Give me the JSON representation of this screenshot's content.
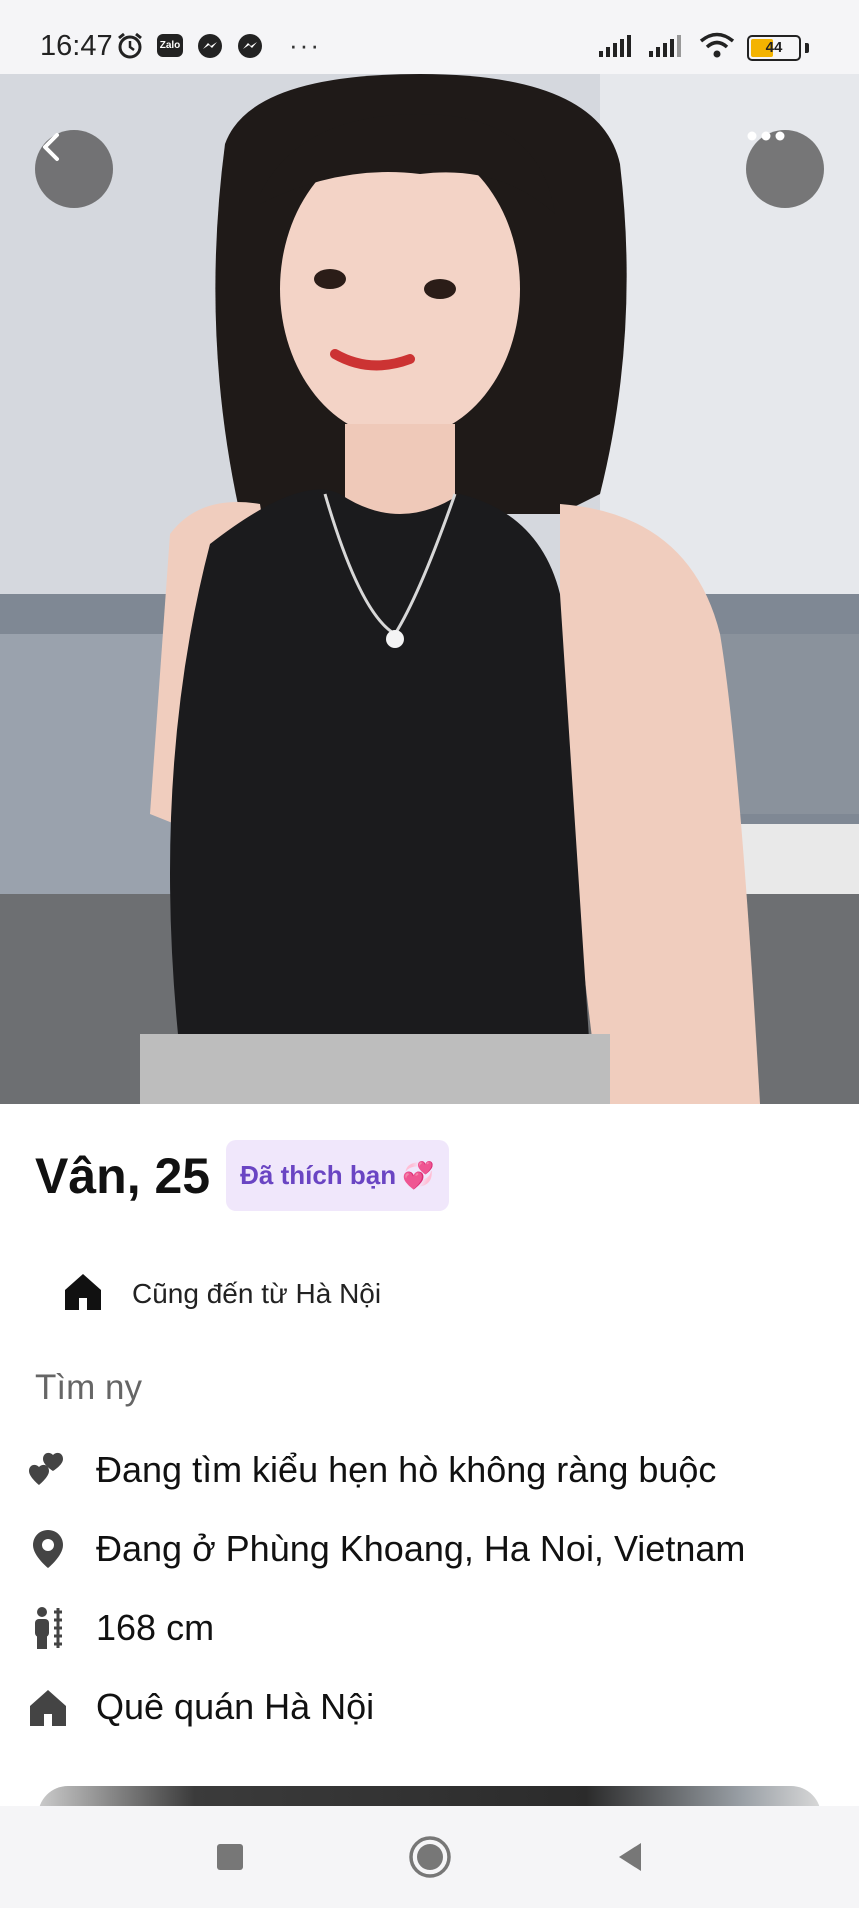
{
  "status_bar": {
    "time": "16:47",
    "left_icons": [
      "alarm-icon",
      "zalo-icon",
      "messenger-icon",
      "messenger-icon"
    ],
    "zalo_label": "Zalo",
    "more": "···",
    "battery_level": "44",
    "battery_fraction": 0.44
  },
  "photo": {
    "back_icon": "chevron-left-icon",
    "more_icon": "more-horizontal-icon"
  },
  "profile": {
    "name_age": "Vân, 25",
    "liked_badge": "Đã thích bạn",
    "liked_emoji": "💞",
    "origin": "Cũng đến từ Hà Nội"
  },
  "details": {
    "section_title": "Tìm ny",
    "items": [
      {
        "icon": "hearts-icon",
        "text": "Đang tìm kiểu hẹn hò không ràng buộc"
      },
      {
        "icon": "location-pin-icon",
        "text": "Đang ở Phùng Khoang, Ha Noi, Vietnam"
      },
      {
        "icon": "height-icon",
        "text": "168 cm"
      },
      {
        "icon": "home-icon",
        "text": "Quê quán Hà Nội"
      }
    ]
  },
  "nav_bar": {
    "recents_icon": "square-icon",
    "home_icon": "circle-icon",
    "back_icon": "triangle-back-icon"
  },
  "colors": {
    "badge_bg": "#f0e7fb",
    "badge_text": "#6a45c3",
    "battery": "#f3b300"
  }
}
